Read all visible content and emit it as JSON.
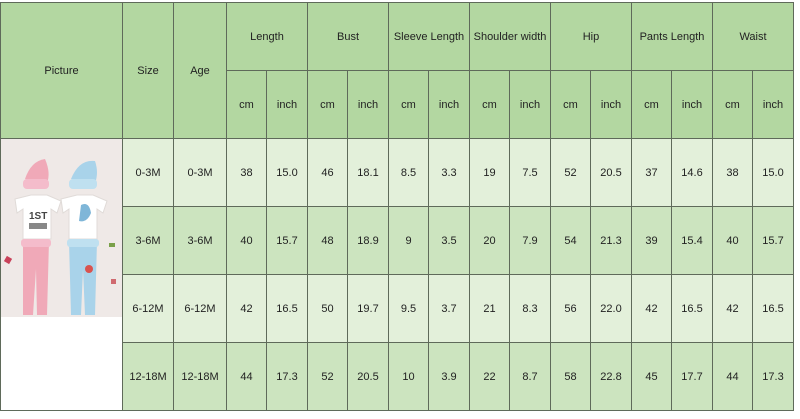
{
  "headers": {
    "picture": "Picture",
    "size": "Size",
    "age": "Age",
    "measurements": [
      "Length",
      "Bust",
      "Sleeve Length",
      "Shoulder width",
      "Hip",
      "Pants Length",
      "Waist"
    ],
    "unit_cm": "cm",
    "unit_inch": "inch"
  },
  "rows": [
    {
      "size": "0-3M",
      "age": "0-3M",
      "values": [
        "38",
        "15.0",
        "46",
        "18.1",
        "8.5",
        "3.3",
        "19",
        "7.5",
        "52",
        "20.5",
        "37",
        "14.6",
        "38",
        "15.0"
      ]
    },
    {
      "size": "3-6M",
      "age": "3-6M",
      "values": [
        "40",
        "15.7",
        "48",
        "18.9",
        "9",
        "3.5",
        "20",
        "7.9",
        "54",
        "21.3",
        "39",
        "15.4",
        "40",
        "15.7"
      ]
    },
    {
      "size": "6-12M",
      "age": "6-12M",
      "values": [
        "42",
        "16.5",
        "50",
        "19.7",
        "9.5",
        "3.7",
        "21",
        "8.3",
        "56",
        "22.0",
        "42",
        "16.5",
        "42",
        "16.5"
      ]
    },
    {
      "size": "12-18M",
      "age": "12-18M",
      "values": [
        "44",
        "17.3",
        "52",
        "20.5",
        "10",
        "3.9",
        "22",
        "8.7",
        "58",
        "22.8",
        "45",
        "17.7",
        "44",
        "17.3"
      ]
    }
  ],
  "product_image": {
    "description_icon": "baby-outfit-photo",
    "shirt_print_left": "1ST",
    "colors": {
      "pink": "#f0a9b8",
      "blue": "#a9d3ea"
    }
  },
  "colors": {
    "header_bg": "#b3d7a1",
    "row_light_bg": "#e3f0da",
    "row_dark_bg": "#cce4bf",
    "grid_line": "#5f6a5a"
  }
}
